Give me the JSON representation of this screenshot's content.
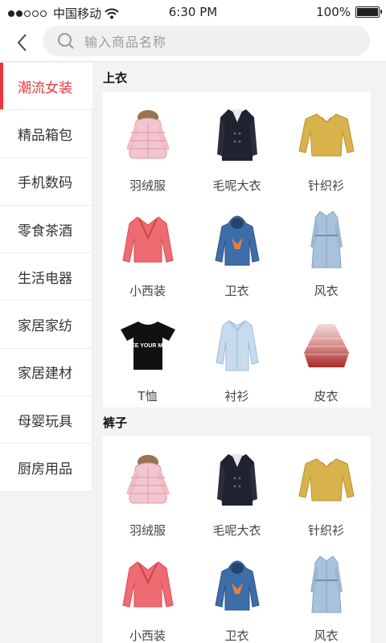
{
  "status_bar": {
    "carrier": "中国移动",
    "time": "6:30 PM",
    "battery": "100%"
  },
  "search": {
    "placeholder": "输入商品名称"
  },
  "sidebar": {
    "items": [
      {
        "label": "潮流女装",
        "active": true
      },
      {
        "label": "精品箱包"
      },
      {
        "label": "手机数码"
      },
      {
        "label": "零食茶酒"
      },
      {
        "label": "生活电器"
      },
      {
        "label": "家居家纺"
      },
      {
        "label": "家居建材"
      },
      {
        "label": "母婴玩具"
      },
      {
        "label": "厨房用品"
      }
    ]
  },
  "sections": [
    {
      "title": "上衣",
      "items": [
        {
          "label": "羽绒服",
          "icon": "down-jacket-icon"
        },
        {
          "label": "毛呢大衣",
          "icon": "wool-coat-icon"
        },
        {
          "label": "针织衫",
          "icon": "knit-cardigan-icon"
        },
        {
          "label": "小西装",
          "icon": "blazer-icon"
        },
        {
          "label": "卫衣",
          "icon": "hoodie-icon"
        },
        {
          "label": "风衣",
          "icon": "trench-coat-icon"
        },
        {
          "label": "T恤",
          "icon": "tshirt-icon",
          "print": "FREE YOUR MIND"
        },
        {
          "label": "衬衫",
          "icon": "shirt-icon"
        },
        {
          "label": "皮衣",
          "icon": "knit-cape-icon"
        }
      ]
    },
    {
      "title": "裤子",
      "items": [
        {
          "label": "羽绒服",
          "icon": "down-jacket-icon"
        },
        {
          "label": "毛呢大衣",
          "icon": "wool-coat-icon"
        },
        {
          "label": "针织衫",
          "icon": "knit-cardigan-icon"
        },
        {
          "label": "小西装",
          "icon": "blazer-icon"
        },
        {
          "label": "卫衣",
          "icon": "hoodie-icon"
        },
        {
          "label": "风衣",
          "icon": "trench-coat-icon"
        }
      ]
    }
  ]
}
